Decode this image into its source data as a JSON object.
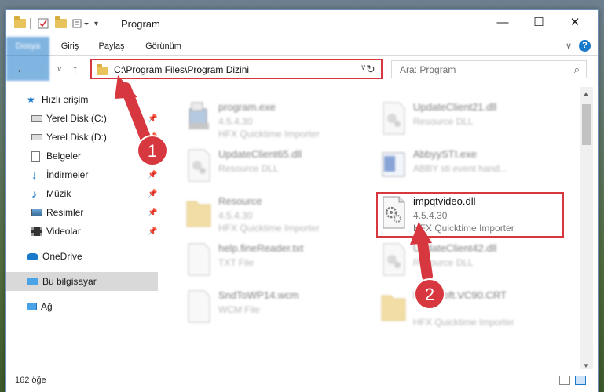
{
  "window": {
    "title": "Program",
    "controls": {
      "minimize": "—",
      "maximize": "☐",
      "close": "✕"
    }
  },
  "ribbon": {
    "tabs": [
      "Dosya",
      "Giriş",
      "Paylaş",
      "Görünüm"
    ],
    "help": "?"
  },
  "address": {
    "path": "C:\\Program Files\\Program Dizini",
    "search_placeholder": "Ara: Program"
  },
  "nav": {
    "items": [
      {
        "label": "Hızlı erişim",
        "icon": "star-icon",
        "pinned": false
      },
      {
        "label": "Yerel Disk (C:)",
        "icon": "drive-icon",
        "pinned": true
      },
      {
        "label": "Yerel Disk (D:)",
        "icon": "drive-icon",
        "pinned": true
      },
      {
        "label": "Belgeler",
        "icon": "document-icon",
        "pinned": true
      },
      {
        "label": "İndirmeler",
        "icon": "download-icon",
        "pinned": true
      },
      {
        "label": "Müzik",
        "icon": "music-icon",
        "pinned": true
      },
      {
        "label": "Resimler",
        "icon": "picture-icon",
        "pinned": true
      },
      {
        "label": "Videolar",
        "icon": "video-icon",
        "pinned": true
      },
      {
        "label": "OneDrive",
        "icon": "cloud-icon",
        "pinned": false
      },
      {
        "label": "Bu bilgisayar",
        "icon": "computer-icon",
        "pinned": false,
        "selected": true
      },
      {
        "label": "Ağ",
        "icon": "network-icon",
        "pinned": false
      }
    ]
  },
  "files": [
    {
      "name": "program.exe",
      "line1": "4.5.4.30",
      "line2": "HFX Quicktime Importer",
      "icon": "exe-icon"
    },
    {
      "name": "UpdateClient21.dll",
      "line1": "Resource DLL",
      "line2": "",
      "icon": "dll-icon"
    },
    {
      "name": "UpdateClient65.dll",
      "line1": "Resource DLL",
      "line2": "",
      "icon": "dll-icon"
    },
    {
      "name": "AbbyySTI.exe",
      "line1": "ABBY sti event hand...",
      "line2": "",
      "icon": "exe-icon"
    },
    {
      "name": "Resource",
      "line1": "4.5.4.30",
      "line2": "HFX Quicktime Importer",
      "icon": "folder-icon"
    },
    {
      "name": "impqtvideo.dll",
      "line1": "4.5.4.30",
      "line2": "HFX Quicktime Importer",
      "icon": "dll-icon",
      "highlighted": true
    },
    {
      "name": "help.fineReader.txt",
      "line1": "TXT File",
      "line2": "",
      "icon": "text-file-icon"
    },
    {
      "name": "UpdateClient42.dll",
      "line1": "Resource DLL",
      "line2": "",
      "icon": "dll-icon"
    },
    {
      "name": "SndToWP14.wcm",
      "line1": "WCM File",
      "line2": "",
      "icon": "file-icon"
    },
    {
      "name": "Microsoft.VC90.CRT",
      "line1": "",
      "line2": "HFX Quicktime Importer",
      "icon": "folder-icon"
    }
  ],
  "status": {
    "count": "162 öğe"
  },
  "annotations": {
    "step1": "1",
    "step2": "2"
  },
  "colors": {
    "accent": "#1979ca",
    "annotation_red": "#d7373f"
  }
}
